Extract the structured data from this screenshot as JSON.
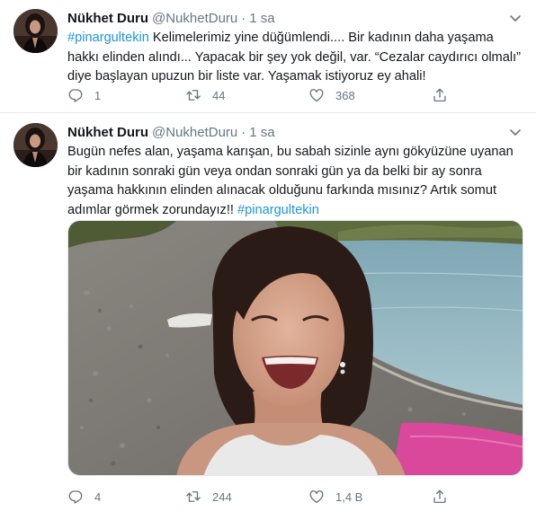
{
  "tweets": [
    {
      "name": "Nükhet Duru",
      "handle": "@NukhetDuru",
      "separator": "·",
      "time": "1 sa",
      "hashtag": "#pinargultekin",
      "text": " Kelimelerimiz yine düğümlendi.... Bir kadının daha yaşama hakkı elinden alındı... Yapacak bir şey yok değil, var. “Cezalar caydırıcı olmalı” diye başlayan upuzun bir liste var. Yaşamak istiyoruz ey ahali!",
      "replies": "1",
      "retweets": "44",
      "likes": "368"
    },
    {
      "name": "Nükhet Duru",
      "handle": "@NukhetDuru",
      "separator": "·",
      "time": "1 sa",
      "text": "Bugün nefes alan, yaşama karışan, bu sabah sizinle aynı gökyüzüne uyanan bir kadının sonraki gün veya ondan sonraki gün ya da belki bir ay sonra yaşama hakkının elinden alınacak olduğunu farkında mısınız? Artık somut adımlar görmek zorundayız!! ",
      "hashtag": "#pinargultekin",
      "replies": "4",
      "retweets": "244",
      "likes": "1,4 B"
    }
  ],
  "icons": {
    "reply": "reply-icon",
    "retweet": "retweet-icon",
    "like": "heart-icon",
    "share": "share-icon",
    "caret": "chevron-down-icon"
  },
  "colors": {
    "link": "#1b95e0",
    "muted": "#657786",
    "text": "#14171a",
    "border": "#e6ecf0"
  }
}
